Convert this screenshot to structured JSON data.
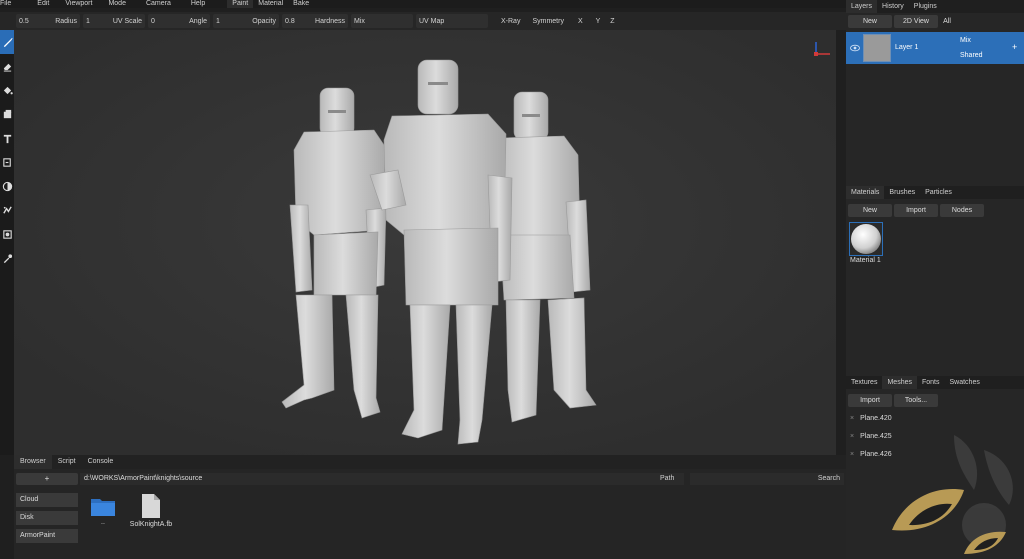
{
  "menu": {
    "items": [
      "File",
      "Edit",
      "Viewport",
      "Mode",
      "Camera",
      "Help"
    ],
    "workspace_tabs": [
      "Paint",
      "Material",
      "Bake"
    ]
  },
  "options": {
    "radius_value": "0.5",
    "radius_label": "Radius",
    "uvscale_value": "1",
    "uvscale_label": "UV Scale",
    "angle_value": "0",
    "angle_label": "Angle",
    "opacity_value": "1",
    "opacity_label": "Opacity",
    "hardness_value": "0.8",
    "hardness_label": "Hardness",
    "blend_value": "Mix",
    "uvmap_label": "UV Map",
    "xray_label": "X-Ray",
    "symmetry_label": "Symmetry",
    "x_label": "X",
    "y_label": "Y",
    "z_label": "Z"
  },
  "layers_panel": {
    "tabs": [
      "Layers",
      "History",
      "Plugins"
    ],
    "new_label": "New",
    "view2d_label": "2D View",
    "all_label": "All",
    "layer": {
      "name": "Layer 1",
      "blend": "Mix",
      "mode": "Shared",
      "plus": "+"
    }
  },
  "materials_panel": {
    "tabs": [
      "Materials",
      "Brushes",
      "Particles"
    ],
    "new_label": "New",
    "import_label": "Import",
    "nodes_label": "Nodes",
    "material_name": "Material 1"
  },
  "meshes_panel": {
    "tabs": [
      "Textures",
      "Meshes",
      "Fonts",
      "Swatches"
    ],
    "import_label": "Import",
    "tools_label": "Tools...",
    "items": [
      "Plane.420",
      "Plane.425",
      "Plane.426"
    ],
    "remove_glyph": "×"
  },
  "browser": {
    "tabs": [
      "Browser",
      "Script",
      "Console"
    ],
    "plus_label": "+",
    "path": "d:\\WORKS\\ArmorPaint\\knights\\source",
    "path_label": "Path",
    "search_label": "Search",
    "side_items": [
      "Cloud",
      "Disk",
      "ArmorPaint"
    ],
    "files": [
      {
        "name": "..",
        "icon": "folder-icon"
      },
      {
        "name": "SolKnightA.fb",
        "icon": "file-icon"
      }
    ]
  },
  "tools": [
    "brush-icon",
    "eraser-icon",
    "fill-icon",
    "decal-icon",
    "text-icon",
    "clone-icon",
    "blur-icon",
    "particle-icon",
    "picker-mask-icon",
    "eyedropper-icon"
  ],
  "colors": {
    "accent": "#2c6fb8",
    "viewport_bg": "#333333",
    "panel_bg": "#262626",
    "logo_gold": "#b89a55"
  }
}
